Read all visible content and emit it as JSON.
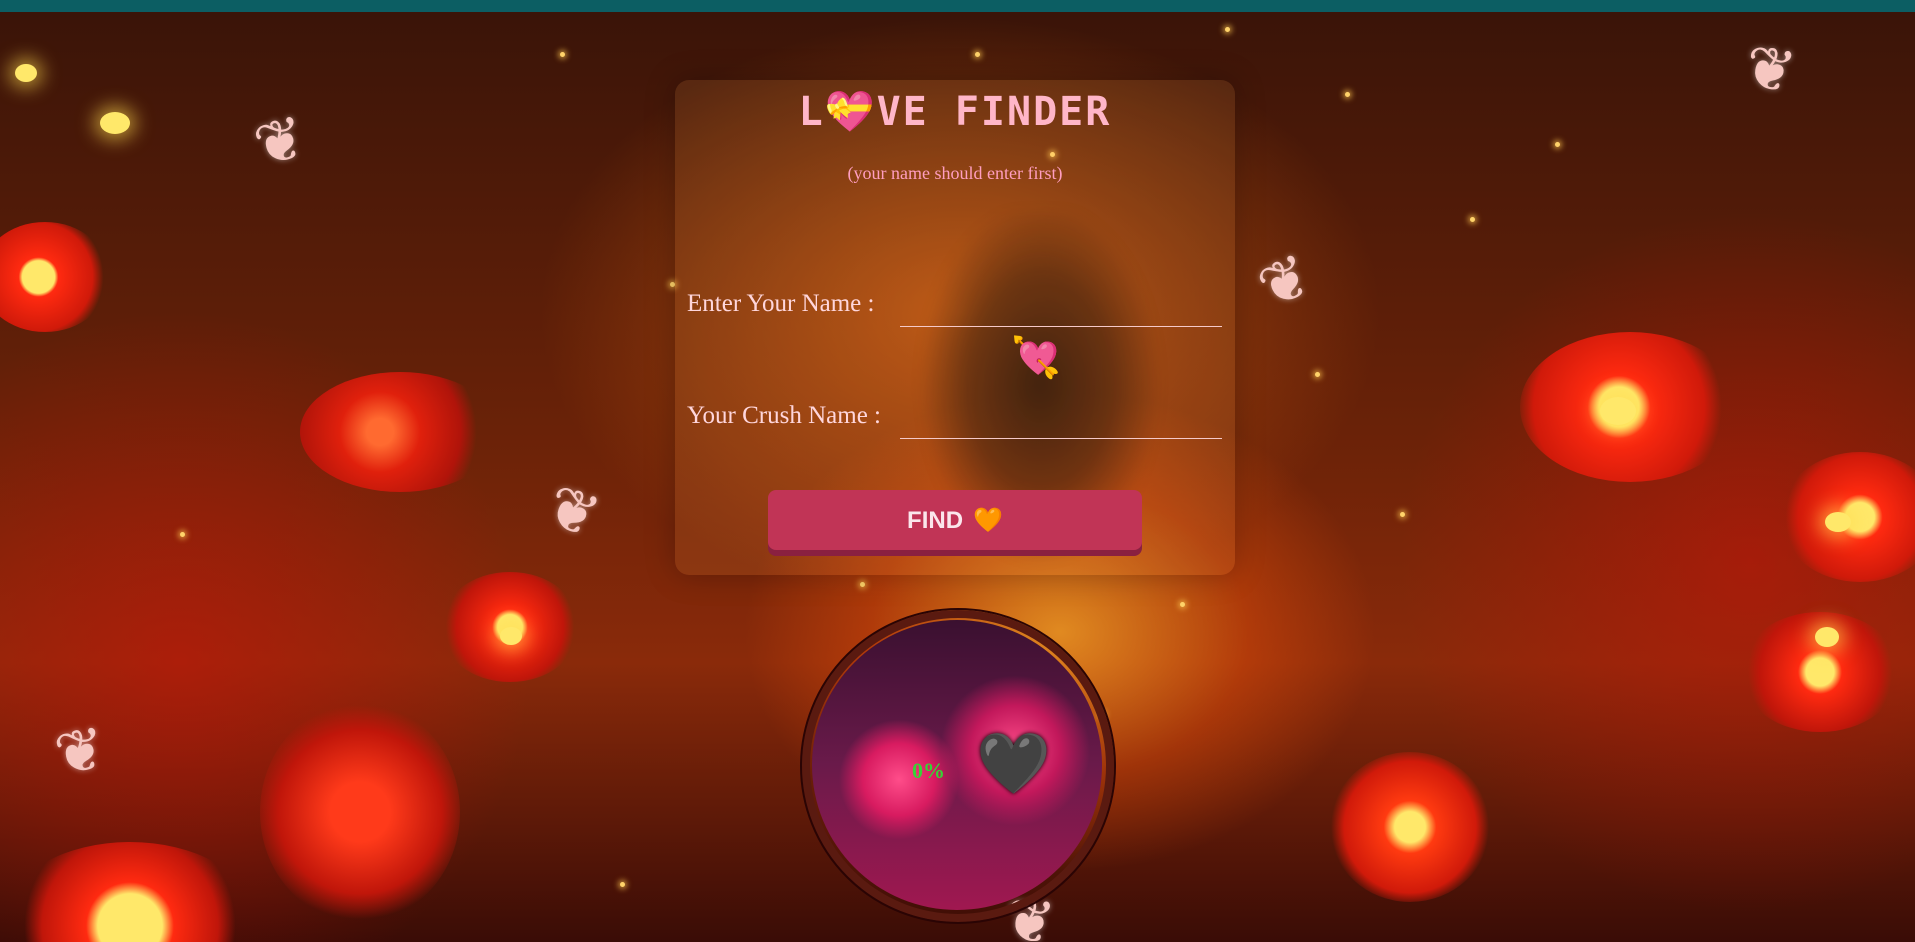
{
  "app": {
    "title_left": "L",
    "title_heart": "💝",
    "title_right": "VE FINDER",
    "subtitle": "(your name should enter first)"
  },
  "form": {
    "your_name_label": "Enter Your Name :",
    "your_name_value": "",
    "crush_name_label": "Your Crush Name :",
    "crush_name_value": "",
    "cupid_icon": "heart-with-arrow-icon",
    "find_label": "FIND",
    "find_icon": "orange-heart-icon"
  },
  "meter": {
    "percent_text": "0%",
    "heart_icon": "black-heart-icon"
  },
  "colors": {
    "topbar": "#0c5e63",
    "title": "#ffb6c8",
    "subtitle": "#ff9ec0",
    "button": "#c13456",
    "percent": "#35d435"
  }
}
